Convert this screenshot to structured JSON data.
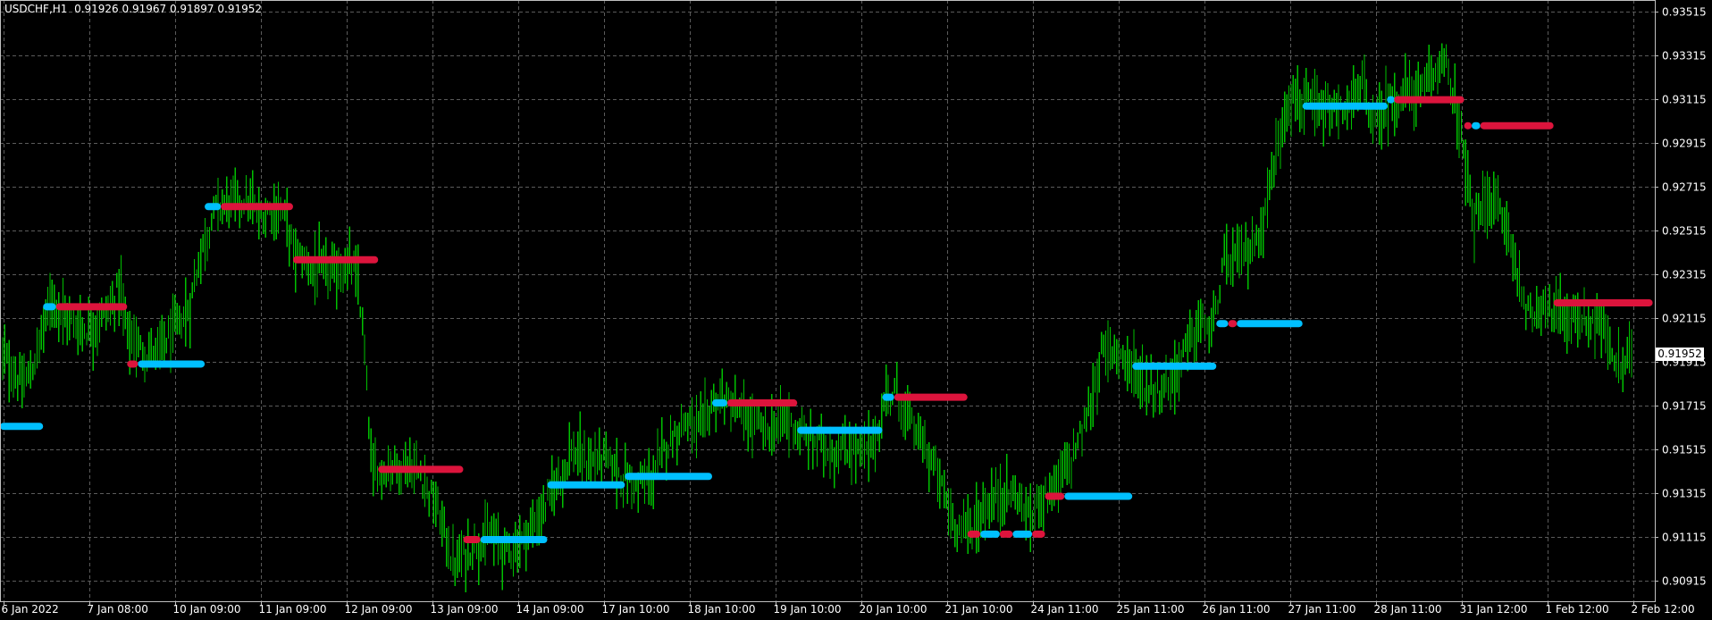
{
  "header": {
    "symbol_timeframe": "USDCHF,H1",
    "ohlc": "0.91926 0.91967 0.91897 0.91952"
  },
  "current_price_label": "0.91952",
  "colors": {
    "background": "#000000",
    "grid": "#5b5b5b",
    "bars": "#00c000",
    "level_up": "#00bfff",
    "level_down": "#dc143c",
    "text": "#ffffff"
  },
  "chart_data": {
    "type": "bar",
    "symbol": "USDCHF",
    "timeframe": "H1",
    "ylim": [
      0.9082,
      0.9357
    ],
    "grid": true,
    "y_ticks": [
      "0.93515",
      "0.93315",
      "0.93115",
      "0.92915",
      "0.92715",
      "0.92515",
      "0.92315",
      "0.92115",
      "0.91915",
      "0.91715",
      "0.91515",
      "0.91315",
      "0.91115",
      "0.90915"
    ],
    "x_ticks": [
      "6 Jan 2022",
      "7 Jan 08:00",
      "10 Jan 09:00",
      "11 Jan 09:00",
      "12 Jan 09:00",
      "13 Jan 09:00",
      "14 Jan 09:00",
      "17 Jan 10:00",
      "18 Jan 10:00",
      "19 Jan 10:00",
      "20 Jan 10:00",
      "21 Jan 10:00",
      "24 Jan 11:00",
      "25 Jan 11:00",
      "26 Jan 11:00",
      "27 Jan 11:00",
      "28 Jan 11:00",
      "31 Jan 12:00",
      "1 Feb 12:00",
      "2 Feb 12:00"
    ],
    "price_path": [
      [
        0,
        0.9196
      ],
      [
        8,
        0.919
      ],
      [
        20,
        0.918
      ],
      [
        30,
        0.9188
      ],
      [
        40,
        0.9208
      ],
      [
        48,
        0.9222
      ],
      [
        60,
        0.9212
      ],
      [
        80,
        0.9206
      ],
      [
        95,
        0.9212
      ],
      [
        105,
        0.9218
      ],
      [
        110,
        0.9228
      ],
      [
        118,
        0.9205
      ],
      [
        125,
        0.92
      ],
      [
        135,
        0.9195
      ],
      [
        145,
        0.9196
      ],
      [
        160,
        0.9205
      ],
      [
        175,
        0.9215
      ],
      [
        185,
        0.924
      ],
      [
        200,
        0.9262
      ],
      [
        215,
        0.9265
      ],
      [
        230,
        0.9265
      ],
      [
        240,
        0.9258
      ],
      [
        255,
        0.9262
      ],
      [
        265,
        0.9258
      ],
      [
        272,
        0.9242
      ],
      [
        290,
        0.9234
      ],
      [
        310,
        0.9232
      ],
      [
        325,
        0.9236
      ],
      [
        332,
        0.9228
      ],
      [
        338,
        0.9195
      ],
      [
        345,
        0.914
      ],
      [
        358,
        0.9143
      ],
      [
        375,
        0.9145
      ],
      [
        390,
        0.914
      ],
      [
        400,
        0.913
      ],
      [
        412,
        0.9115
      ],
      [
        420,
        0.9098
      ],
      [
        440,
        0.9108
      ],
      [
        455,
        0.9112
      ],
      [
        470,
        0.9105
      ],
      [
        485,
        0.911
      ],
      [
        500,
        0.912
      ],
      [
        515,
        0.9135
      ],
      [
        530,
        0.915
      ],
      [
        545,
        0.9145
      ],
      [
        560,
        0.9148
      ],
      [
        575,
        0.914
      ],
      [
        590,
        0.9135
      ],
      [
        605,
        0.9138
      ],
      [
        620,
        0.9155
      ],
      [
        635,
        0.9165
      ],
      [
        650,
        0.916
      ],
      [
        660,
        0.9172
      ],
      [
        670,
        0.9175
      ],
      [
        685,
        0.9168
      ],
      [
        700,
        0.9163
      ],
      [
        715,
        0.916
      ],
      [
        730,
        0.9165
      ],
      [
        745,
        0.9157
      ],
      [
        760,
        0.9155
      ],
      [
        775,
        0.915
      ],
      [
        790,
        0.9152
      ],
      [
        805,
        0.915
      ],
      [
        815,
        0.916
      ],
      [
        822,
        0.9175
      ],
      [
        830,
        0.9178
      ],
      [
        840,
        0.9168
      ],
      [
        855,
        0.9155
      ],
      [
        870,
        0.914
      ],
      [
        885,
        0.9118
      ],
      [
        900,
        0.9115
      ],
      [
        915,
        0.9125
      ],
      [
        930,
        0.9132
      ],
      [
        945,
        0.913
      ],
      [
        955,
        0.9118
      ],
      [
        965,
        0.913
      ],
      [
        980,
        0.9135
      ],
      [
        995,
        0.9148
      ],
      [
        1010,
        0.9168
      ],
      [
        1022,
        0.9195
      ],
      [
        1035,
        0.9198
      ],
      [
        1050,
        0.919
      ],
      [
        1060,
        0.9182
      ],
      [
        1075,
        0.9178
      ],
      [
        1090,
        0.9185
      ],
      [
        1100,
        0.9198
      ],
      [
        1115,
        0.921
      ],
      [
        1125,
        0.9205
      ],
      [
        1135,
        0.9235
      ],
      [
        1150,
        0.924
      ],
      [
        1165,
        0.9245
      ],
      [
        1175,
        0.9262
      ],
      [
        1185,
        0.929
      ],
      [
        1195,
        0.9313
      ],
      [
        1210,
        0.931
      ],
      [
        1225,
        0.9305
      ],
      [
        1240,
        0.9305
      ],
      [
        1255,
        0.931
      ],
      [
        1265,
        0.9318
      ],
      [
        1275,
        0.93
      ],
      [
        1290,
        0.931
      ],
      [
        1305,
        0.9315
      ],
      [
        1320,
        0.9315
      ],
      [
        1330,
        0.932
      ],
      [
        1340,
        0.9335
      ],
      [
        1348,
        0.931
      ],
      [
        1355,
        0.93
      ],
      [
        1362,
        0.927
      ],
      [
        1368,
        0.9255
      ],
      [
        1380,
        0.9268
      ],
      [
        1392,
        0.926
      ],
      [
        1400,
        0.925
      ],
      [
        1410,
        0.9228
      ],
      [
        1420,
        0.921
      ],
      [
        1430,
        0.922
      ],
      [
        1440,
        0.9215
      ],
      [
        1455,
        0.9213
      ],
      [
        1470,
        0.921
      ],
      [
        1485,
        0.921
      ],
      [
        1495,
        0.9195
      ],
      [
        1505,
        0.9188
      ],
      [
        1515,
        0.9195
      ]
    ],
    "levels": [
      {
        "start": 0,
        "end": 40,
        "price": 0.9162,
        "color": "up"
      },
      {
        "start": 40,
        "end": 52,
        "price": 0.92167,
        "color": "up"
      },
      {
        "start": 52,
        "end": 118,
        "price": 0.92167,
        "color": "down"
      },
      {
        "start": 118,
        "end": 128,
        "price": 0.91905,
        "color": "down"
      },
      {
        "start": 128,
        "end": 190,
        "price": 0.91905,
        "color": "up"
      },
      {
        "start": 190,
        "end": 205,
        "price": 0.92625,
        "color": "up"
      },
      {
        "start": 205,
        "end": 272,
        "price": 0.92625,
        "color": "down"
      },
      {
        "start": 272,
        "end": 351,
        "price": 0.92382,
        "color": "down"
      },
      {
        "start": 351,
        "end": 430,
        "price": 0.91423,
        "color": "down"
      },
      {
        "start": 430,
        "end": 446,
        "price": 0.91102,
        "color": "down"
      },
      {
        "start": 446,
        "end": 508,
        "price": 0.91102,
        "color": "up"
      },
      {
        "start": 508,
        "end": 580,
        "price": 0.91352,
        "color": "up"
      },
      {
        "start": 580,
        "end": 661,
        "price": 0.91391,
        "color": "up"
      },
      {
        "start": 661,
        "end": 675,
        "price": 0.91727,
        "color": "up"
      },
      {
        "start": 675,
        "end": 740,
        "price": 0.91727,
        "color": "down"
      },
      {
        "start": 740,
        "end": 819,
        "price": 0.91602,
        "color": "up"
      },
      {
        "start": 819,
        "end": 830,
        "price": 0.91753,
        "color": "up"
      },
      {
        "start": 830,
        "end": 898,
        "price": 0.91753,
        "color": "down"
      },
      {
        "start": 898,
        "end": 910,
        "price": 0.91127,
        "color": "down"
      },
      {
        "start": 910,
        "end": 928,
        "price": 0.91127,
        "color": "up"
      },
      {
        "start": 928,
        "end": 940,
        "price": 0.91127,
        "color": "down"
      },
      {
        "start": 940,
        "end": 958,
        "price": 0.91127,
        "color": "up"
      },
      {
        "start": 958,
        "end": 970,
        "price": 0.91127,
        "color": "down"
      },
      {
        "start": 970,
        "end": 988,
        "price": 0.913,
        "color": "down"
      },
      {
        "start": 988,
        "end": 1051,
        "price": 0.913,
        "color": "up"
      },
      {
        "start": 1051,
        "end": 1129,
        "price": 0.91895,
        "color": "up"
      },
      {
        "start": 1129,
        "end": 1140,
        "price": 0.9209,
        "color": "up"
      },
      {
        "start": 1140,
        "end": 1148,
        "price": 0.9209,
        "color": "down"
      },
      {
        "start": 1148,
        "end": 1209,
        "price": 0.9209,
        "color": "up"
      },
      {
        "start": 1209,
        "end": 1288,
        "price": 0.93085,
        "color": "up"
      },
      {
        "start": 1288,
        "end": 1294,
        "price": 0.93114,
        "color": "up"
      },
      {
        "start": 1294,
        "end": 1359,
        "price": 0.93114,
        "color": "down"
      },
      {
        "start": 1359,
        "end": 1366,
        "price": 0.92995,
        "color": "down"
      },
      {
        "start": 1366,
        "end": 1374,
        "price": 0.92995,
        "color": "up"
      },
      {
        "start": 1374,
        "end": 1442,
        "price": 0.92995,
        "color": "down"
      },
      {
        "start": 1442,
        "end": 1534,
        "price": 0.92185,
        "color": "down"
      }
    ]
  }
}
